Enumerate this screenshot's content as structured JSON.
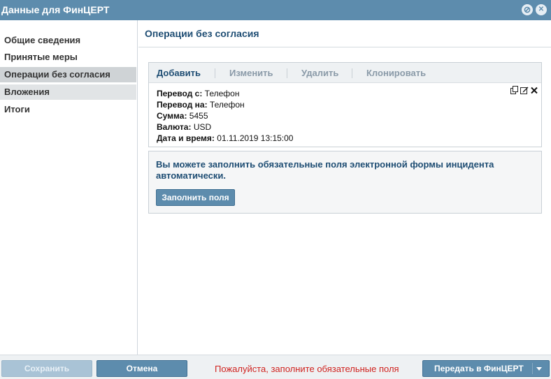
{
  "window": {
    "title": "Данные для ФинЦЕРТ"
  },
  "sidebar": {
    "items": [
      {
        "label": "Общие сведения"
      },
      {
        "label": "Принятые меры"
      },
      {
        "label": "Операции без согласия"
      },
      {
        "label": "Вложения"
      },
      {
        "label": "Итоги"
      }
    ],
    "selected": "Операции без согласия"
  },
  "main": {
    "title": "Операции без согласия",
    "toolbar": {
      "add": "Добавить",
      "edit": "Изменить",
      "delete": "Удалить",
      "clone": "Клонировать"
    },
    "record": {
      "fields": [
        {
          "label": "Перевод с:",
          "value": "Телефон"
        },
        {
          "label": "Перевод на:",
          "value": "Телефон"
        },
        {
          "label": "Сумма:",
          "value": "5455"
        },
        {
          "label": "Валюта:",
          "value": "USD"
        },
        {
          "label": "Дата и время:",
          "value": "01.11.2019 13:15:00"
        }
      ],
      "icons": [
        "copy-icon",
        "edit-icon",
        "close-icon"
      ]
    },
    "autofill": {
      "text": "Вы можете заполнить обязательные поля электронной формы инцидента автоматически.",
      "button": "Заполнить поля"
    }
  },
  "footer": {
    "save": "Сохранить",
    "cancel": "Отмена",
    "message": "Пожалуйста, заполните обязательные поля",
    "send": "Передать в ФинЦЕРТ"
  },
  "colors": {
    "accent": "#5d8cad",
    "heading": "#1e4d73",
    "error": "#d0231f"
  }
}
